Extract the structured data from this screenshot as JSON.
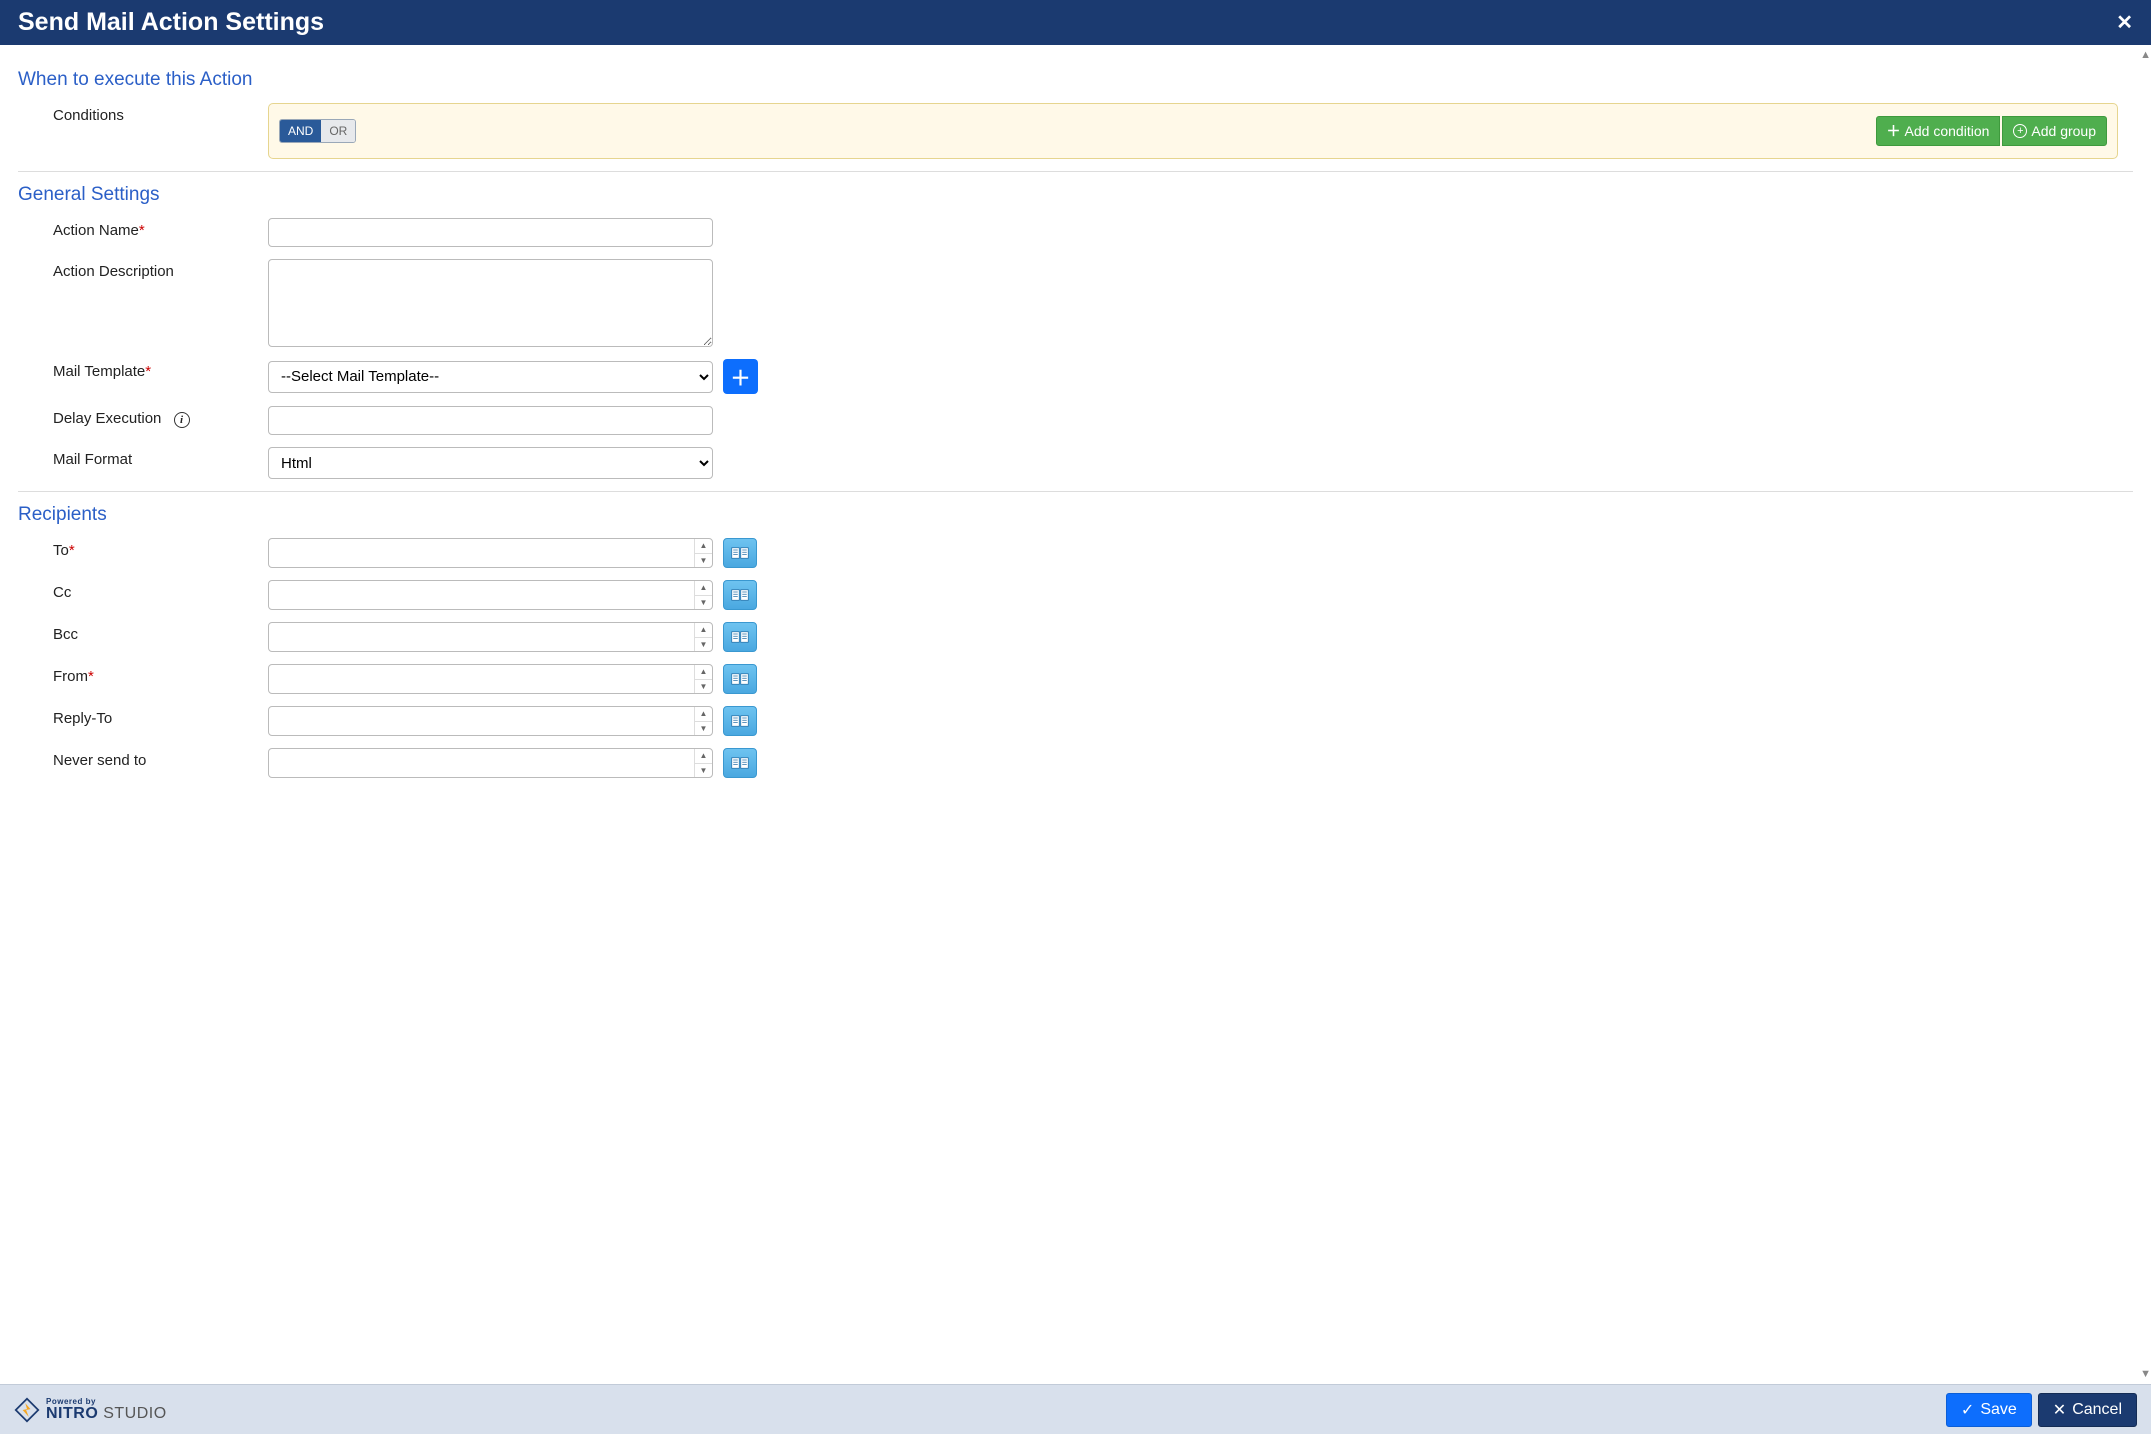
{
  "header": {
    "title": "Send Mail Action Settings"
  },
  "sections": {
    "when": {
      "title": "When to execute this Action",
      "conditions_label": "Conditions",
      "and_label": "AND",
      "or_label": "OR",
      "add_condition_label": "Add condition",
      "add_group_label": "Add group"
    },
    "general": {
      "title": "General Settings",
      "action_name_label": "Action Name",
      "action_name_value": "",
      "action_desc_label": "Action Description",
      "action_desc_value": "",
      "mail_template_label": "Mail Template",
      "mail_template_placeholder": "--Select Mail Template--",
      "delay_label": "Delay Execution",
      "delay_value": "",
      "mail_format_label": "Mail Format",
      "mail_format_value": "Html"
    },
    "recipients": {
      "title": "Recipients",
      "to_label": "To",
      "cc_label": "Cc",
      "bcc_label": "Bcc",
      "from_label": "From",
      "reply_to_label": "Reply-To",
      "never_label": "Never send to"
    }
  },
  "footer": {
    "powered_by": "Powered by",
    "brand_strong": "NITRO",
    "brand_light": " STUDIO",
    "save_label": "Save",
    "cancel_label": "Cancel"
  }
}
